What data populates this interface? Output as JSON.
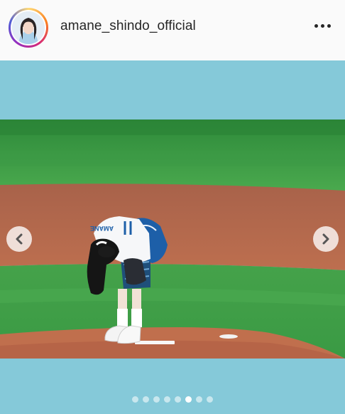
{
  "post": {
    "username": "amane_shindo_official"
  },
  "photo": {
    "jersey_text": "AMANE"
  },
  "carousel": {
    "slide_count": 8,
    "active_index": 5
  },
  "colors": {
    "header_bg": "#fafafa",
    "frame_bg": "#85c9d9",
    "grass": "#3f9b45",
    "dirt": "#b5674a"
  },
  "icons": {
    "more": "more-options-icon",
    "prev": "chevron-left-icon",
    "next": "chevron-right-icon"
  }
}
